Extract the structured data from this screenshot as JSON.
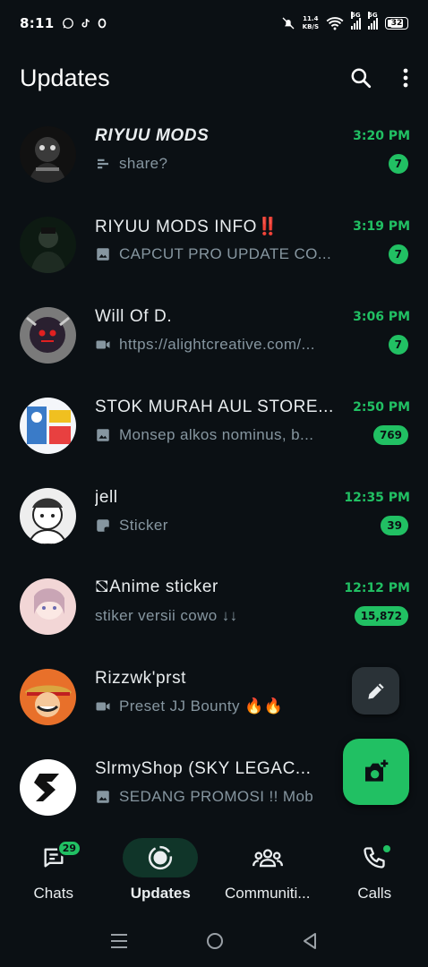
{
  "status": {
    "time": "8:11",
    "speed_value": "11.4",
    "speed_unit": "KB/S",
    "net1": "5G",
    "net2": "5G",
    "battery": "32"
  },
  "header": {
    "title": "Updates"
  },
  "chats": [
    {
      "name": "RIYUU MODS",
      "time": "3:20 PM",
      "preview": "share?",
      "preview_icon": "poll-icon",
      "badge": "7",
      "avatar_colors": [
        "#1a1a1a",
        "#555"
      ]
    },
    {
      "name": "RIYUU MODS INFO‼️",
      "time": "3:19 PM",
      "preview": "CAPCUT PRO UPDATE CO...",
      "preview_icon": "image-icon",
      "badge": "7",
      "avatar_colors": [
        "#0d1a12",
        "#2d4a3a"
      ]
    },
    {
      "name": "Will Of D.",
      "time": "3:06 PM",
      "preview": "https://alightcreative.com/...",
      "preview_icon": "video-icon",
      "badge": "7",
      "avatar_colors": [
        "#6d6d6d",
        "#2a2a2a"
      ]
    },
    {
      "name": "STOK MURAH AUL STORE...",
      "time": "2:50 PM",
      "preview": "Monsep alkos nominus, b...",
      "preview_icon": "image-icon",
      "badge": "769",
      "avatar_colors": [
        "#e8f0f8",
        "#3a7bc8"
      ]
    },
    {
      "name": "jell",
      "time": "12:35 PM",
      "preview": "Sticker",
      "preview_icon": "sticker-icon",
      "badge": "39",
      "avatar_colors": [
        "#eeeeee",
        "#555555"
      ]
    },
    {
      "name": "⛞Anime sticker",
      "time": "12:12 PM",
      "preview": "stiker versii cowo ↓↓",
      "preview_icon": "",
      "badge": "15,872",
      "avatar_colors": [
        "#f2d6d6",
        "#b89aa8"
      ]
    },
    {
      "name": "Rizzwk'prst",
      "time": "",
      "preview": "Preset JJ Bounty 🔥🔥",
      "preview_icon": "video-icon",
      "badge": "",
      "avatar_colors": [
        "#e8702a",
        "#7a3a1a"
      ]
    },
    {
      "name": "SlrmyShop (SKY LEGAC...",
      "time": "",
      "preview": "SEDANG PROMOSI !!  Mob",
      "preview_icon": "image-icon",
      "badge": "",
      "avatar_colors": [
        "#ffffff",
        "#111111"
      ]
    }
  ],
  "nav": [
    {
      "label": "Chats",
      "badge": "29"
    },
    {
      "label": "Updates"
    },
    {
      "label": "Communiti..."
    },
    {
      "label": "Calls"
    }
  ]
}
